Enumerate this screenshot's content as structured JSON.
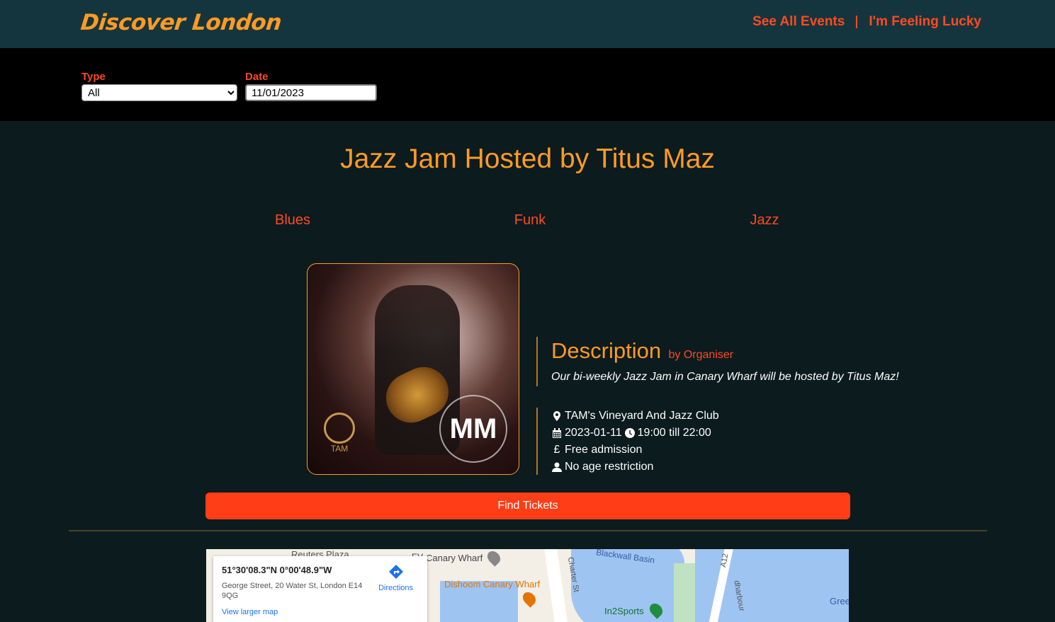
{
  "header": {
    "brand": "Discover London",
    "nav": {
      "see_all": "See All Events",
      "lucky": "I'm Feeling Lucky"
    }
  },
  "filters": {
    "type_label": "Type",
    "type_value": "All",
    "date_label": "Date",
    "date_value": "11/01/2023"
  },
  "event": {
    "title": "Jazz Jam Hosted by Titus Maz",
    "genres": [
      "Blues",
      "Funk",
      "Jazz"
    ],
    "description_heading": "Description",
    "description_by": "by Organiser",
    "description_text": "Our bi-weekly Jazz Jam in Canary Wharf will be hosted by Titus Maz!",
    "venue": "TAM's Vineyard And Jazz Club",
    "date": "2023-01-11",
    "time": "19:00 till 22:00",
    "price_symbol": "£",
    "price": "Free admission",
    "age": "No age restriction",
    "tickets_label": "Find Tickets",
    "poster_logo_right": "MM",
    "poster_logo_left": "TAM"
  },
  "map": {
    "coords": "51°30'08.3\"N 0°00'48.9\"W",
    "address": "George Street, 20 Water St, London E14 9QG",
    "larger_map": "View larger map",
    "directions": "Directions",
    "labels": {
      "reuters": "Reuters Plaza",
      "canary": "Canary Wharf",
      "dishoom": "Dishoom Canary Wharf",
      "blackwall": "Blackwall Basin",
      "in2sports": "In2Sports",
      "charter": "Charter St",
      "a12": "A12",
      "harbour": "dharbour",
      "gree": "Gree",
      "ev": "EV"
    }
  },
  "colors": {
    "accent_orange": "#ff9a24",
    "accent_red": "#ff4a1f",
    "button": "#ff3d16",
    "header_bg": "#15353e",
    "page_bg": "#0b1b1e"
  }
}
